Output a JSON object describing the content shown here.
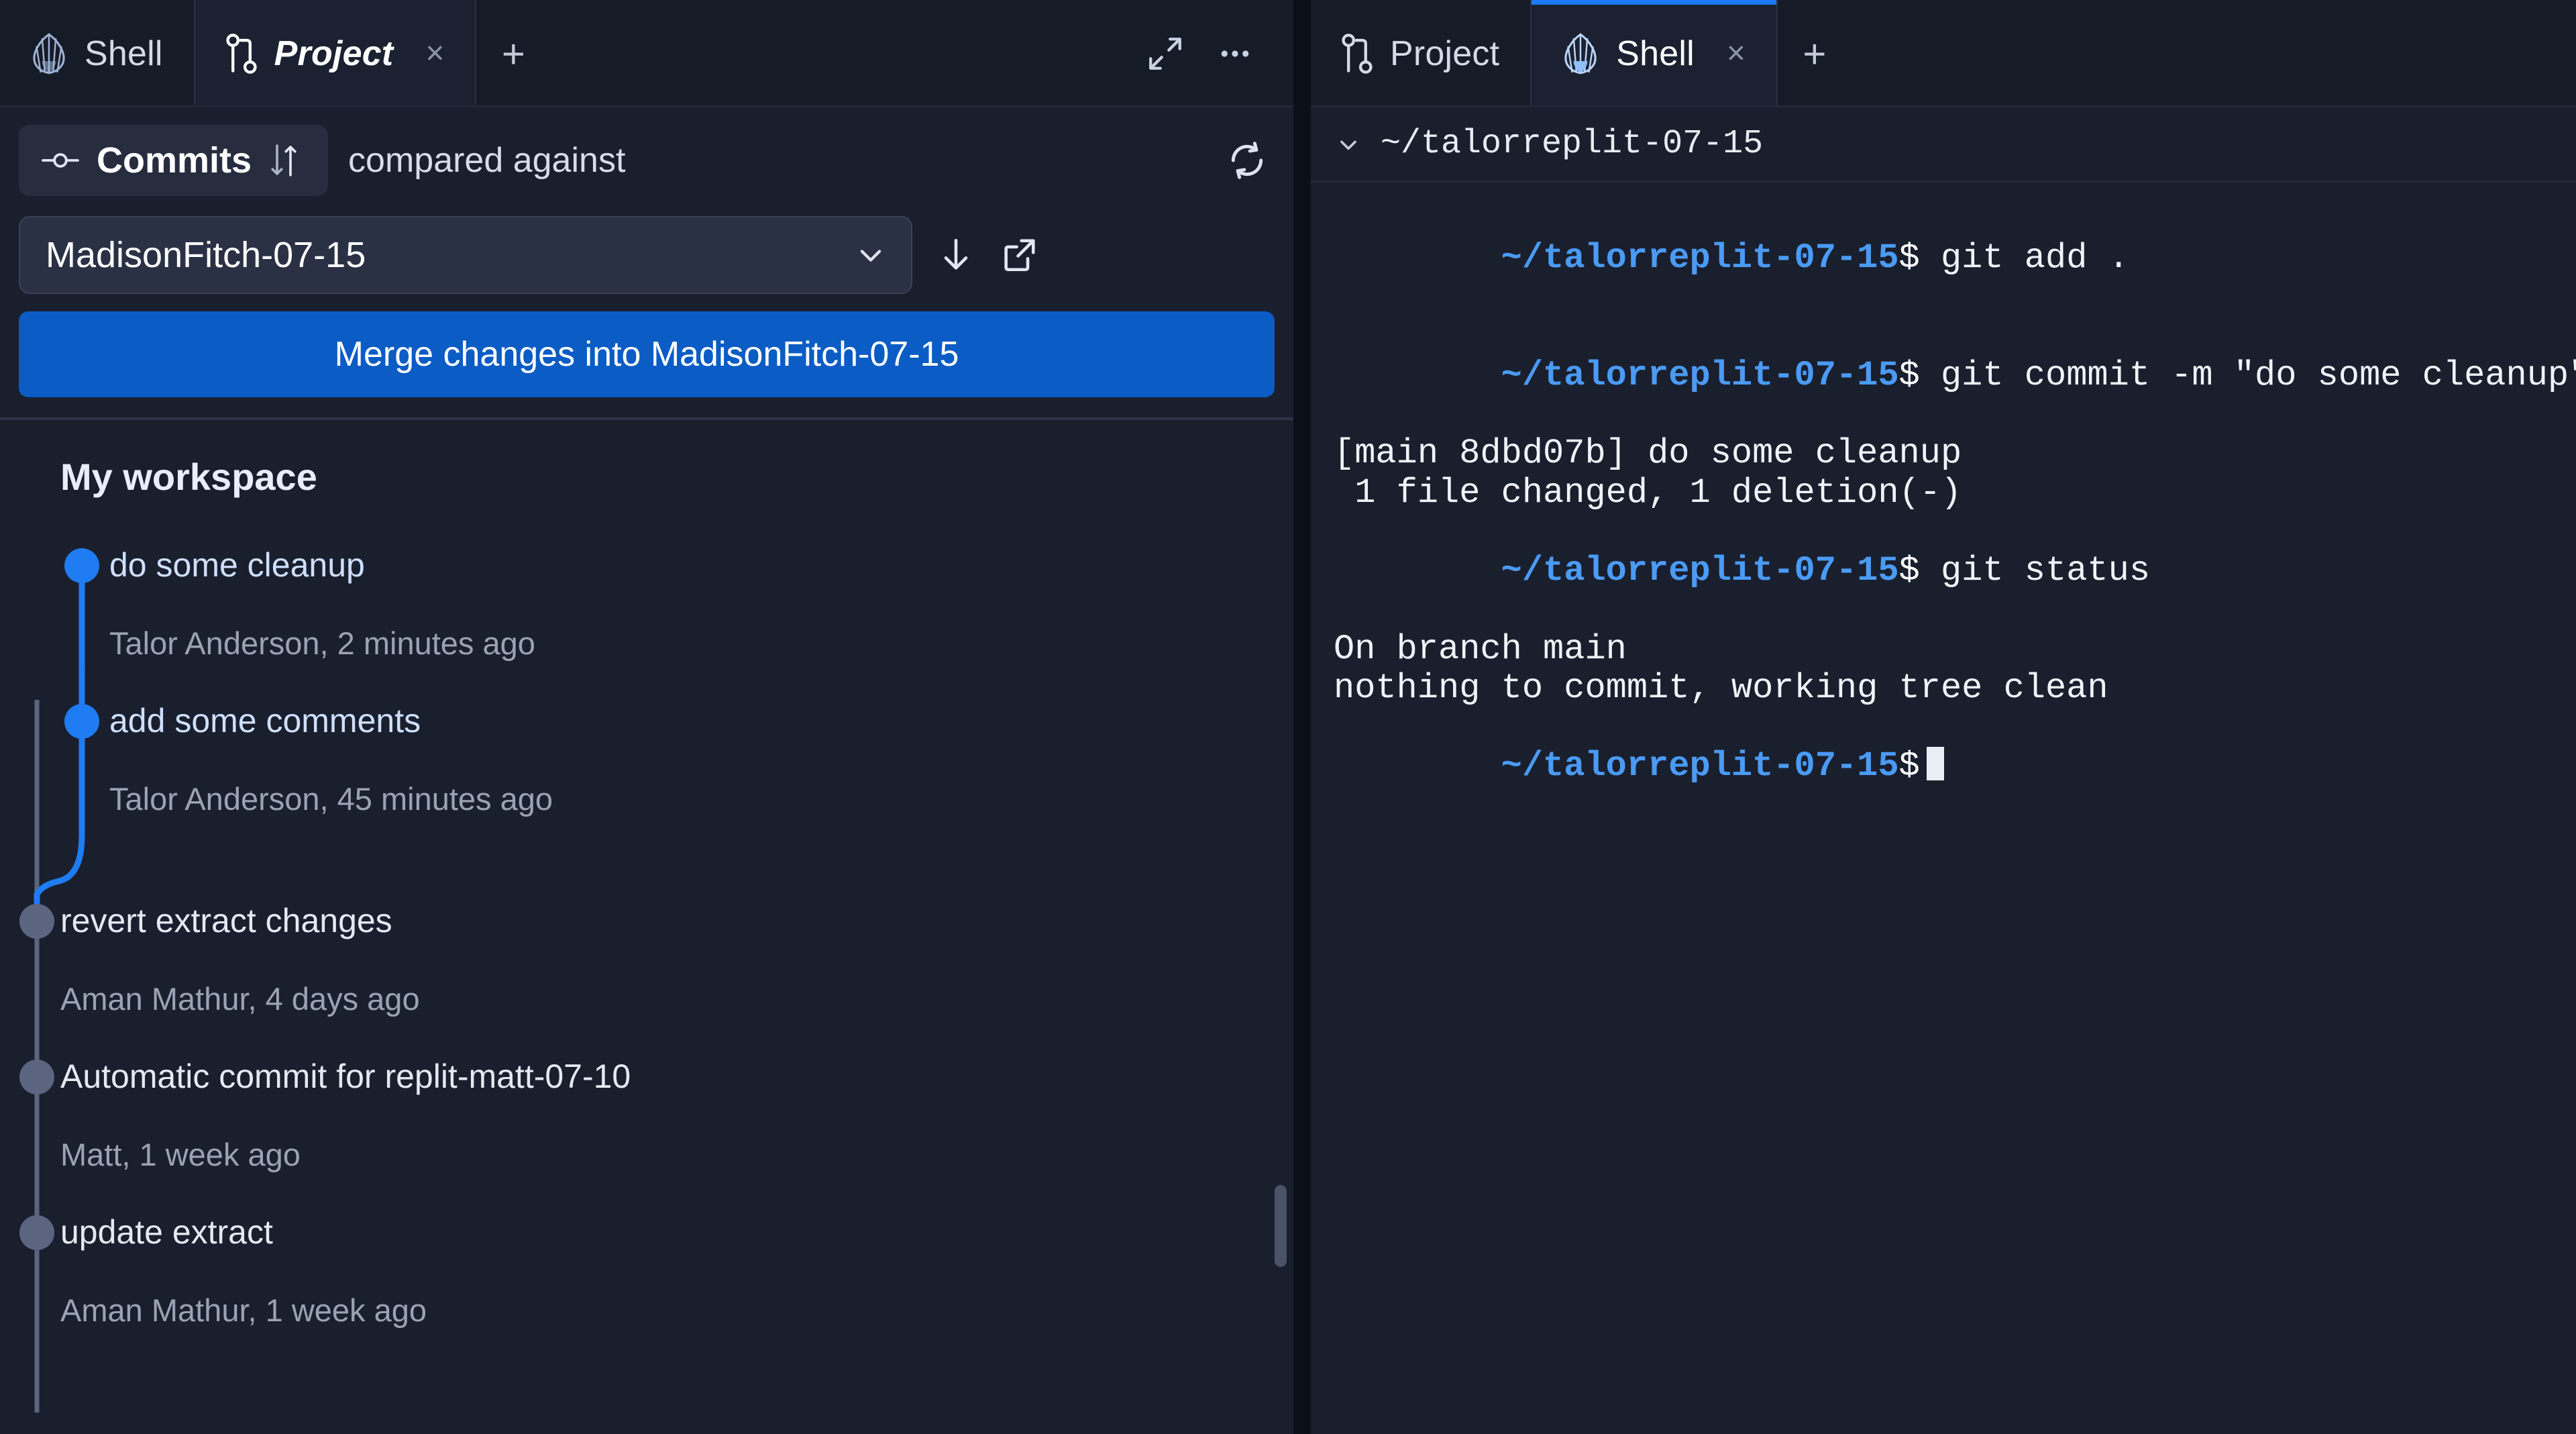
{
  "left_pane": {
    "tabs": [
      {
        "label": "Shell",
        "icon": "shell-icon",
        "active": false,
        "closable": false,
        "italic": false
      },
      {
        "label": "Project",
        "icon": "git-branch-icon",
        "active": true,
        "closable": true,
        "italic": true
      }
    ],
    "new_tab_label": "+",
    "close_label": "×",
    "actions": {
      "expand": "expand-icon",
      "more": "more-options-icon"
    }
  },
  "right_pane": {
    "tabs": [
      {
        "label": "Project",
        "icon": "git-branch-icon",
        "active": false,
        "closable": false,
        "italic": false
      },
      {
        "label": "Shell",
        "icon": "shell-icon",
        "active": true,
        "closable": true,
        "italic": false
      }
    ],
    "new_tab_label": "+",
    "close_label": "×"
  },
  "toolbar": {
    "commits_label": "Commits",
    "compare_label": "compared against",
    "branch_value": "MadisonFitch-07-15",
    "merge_label": "Merge changes into MadisonFitch-07-15"
  },
  "commits": {
    "section_title": "My workspace",
    "items": [
      {
        "message": "do some cleanup",
        "meta": "Talor Anderson, 2 minutes ago",
        "branch": "local"
      },
      {
        "message": "add some comments",
        "meta": "Talor Anderson, 45 minutes ago",
        "branch": "local"
      },
      {
        "message": "revert extract changes",
        "meta": "Aman Mathur, 4 days ago",
        "branch": "main"
      },
      {
        "message": "Automatic commit for replit-matt-07-10",
        "meta": "Matt, 1 week ago",
        "branch": "main"
      },
      {
        "message": "update extract",
        "meta": "Aman Mathur, 1 week ago",
        "branch": "main"
      }
    ]
  },
  "terminal": {
    "cwd": "~/talorreplit-07-15",
    "prompt": "~/talorreplit-07-15",
    "dollar": "$",
    "lines": [
      {
        "type": "command",
        "text": " git add ."
      },
      {
        "type": "command",
        "text": " git commit -m \"do some cleanup\""
      },
      {
        "type": "output",
        "text": "[main 8dbd07b] do some cleanup"
      },
      {
        "type": "output",
        "text": " 1 file changed, 1 deletion(-)"
      },
      {
        "type": "command",
        "text": " git status"
      },
      {
        "type": "output",
        "text": "On branch main"
      },
      {
        "type": "output",
        "text": "nothing to commit, working tree clean"
      },
      {
        "type": "cursor",
        "text": ""
      }
    ]
  },
  "colors": {
    "accent_blue": "#1d7afc",
    "merge_button": "#0b5cc4",
    "graph_branch": "#1f7cf2",
    "graph_main": "#5c6580",
    "panel_bg": "#1a1f2e",
    "tabbar_bg": "#161b28",
    "prompt_blue": "#4a9bf5"
  }
}
